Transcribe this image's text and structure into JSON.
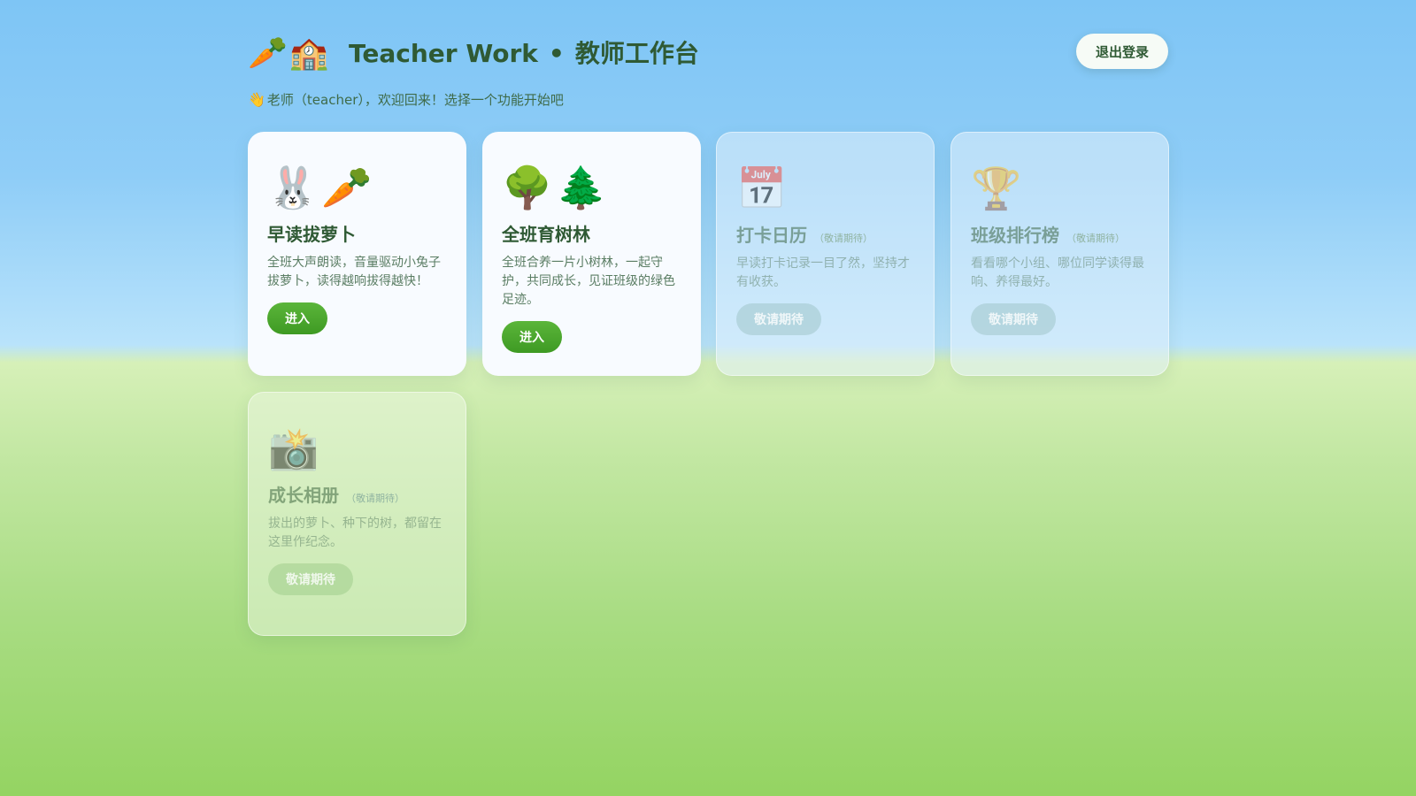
{
  "header": {
    "logo_emoji": "🥕🏫",
    "title_en": "Teacher Work",
    "title_sep": "•",
    "title_cn": "教师工作台",
    "logout_label": "退出登录"
  },
  "welcome": {
    "wave": "👋",
    "text": "老师（teacher），欢迎回来！选择一个功能开始吧"
  },
  "cards": [
    {
      "emoji": "🐰🥕",
      "title": "早读拔萝卜",
      "tag": "",
      "desc": "全班大声朗读，音量驱动小兔子拔萝卜，读得越响拔得越快！",
      "button": "进入",
      "enabled": true
    },
    {
      "emoji": "🌳🌲",
      "title": "全班育树林",
      "tag": "",
      "desc": "全班合养一片小树林，一起守护，共同成长，见证班级的绿色足迹。",
      "button": "进入",
      "enabled": true
    },
    {
      "emoji": "📅",
      "title": "打卡日历",
      "tag": "（敬请期待）",
      "desc": "早读打卡记录一目了然，坚持才有收获。",
      "button": "敬请期待",
      "enabled": false
    },
    {
      "emoji": "🏆",
      "title": "班级排行榜",
      "tag": "（敬请期待）",
      "desc": "看看哪个小组、哪位同学读得最响、养得最好。",
      "button": "敬请期待",
      "enabled": false
    },
    {
      "emoji": "📸",
      "title": "成长相册",
      "tag": "（敬请期待）",
      "desc": "拔出的萝卜、种下的树，都留在这里作纪念。",
      "button": "敬请期待",
      "enabled": false
    }
  ]
}
